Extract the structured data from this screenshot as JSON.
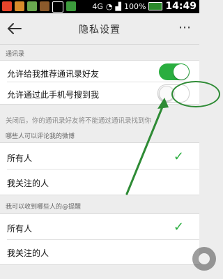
{
  "status_bar": {
    "signal": "4G",
    "battery": "100%",
    "time": "14:49"
  },
  "header": {
    "title": "隐私设置",
    "more": "⋯"
  },
  "contacts_section": {
    "label": "通讯录",
    "items": [
      {
        "label": "允许给我推荐通讯录好友",
        "toggle": "on"
      },
      {
        "label": "允许通过此手机号搜到我",
        "toggle": "off"
      }
    ],
    "hint": "关闭后，你的通讯录好友将不能通过通讯录找到你"
  },
  "comment_section": {
    "label": "哪些人可以评论我的微博",
    "options": [
      {
        "label": "所有人",
        "selected": true
      },
      {
        "label": "我关注的人",
        "selected": false
      }
    ]
  },
  "mention_section": {
    "label": "我可以收到哪些人的@提醒",
    "options": [
      {
        "label": "所有人",
        "selected": true
      },
      {
        "label": "我关注的人",
        "selected": false
      }
    ]
  },
  "colors": {
    "accent": "#2aae3f",
    "annotation": "#2e8b35"
  },
  "icons": {
    "back": "arrow-left-icon",
    "check": "checkmark-icon",
    "more": "more-dots-icon"
  }
}
